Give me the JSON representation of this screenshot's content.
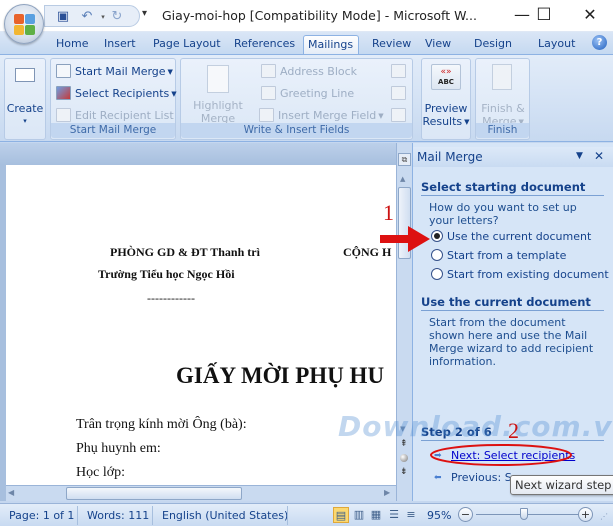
{
  "window": {
    "title": "Giay-moi-hop [Compatibility Mode] - Microsoft W...",
    "minimize": "—",
    "maximize": "☐",
    "close": "✕"
  },
  "qat": {
    "save_icon": "save-icon",
    "undo_icon": "undo-icon",
    "redo_icon": "redo-icon",
    "customize": "▾"
  },
  "tabs": [
    {
      "label": "Home"
    },
    {
      "label": "Insert"
    },
    {
      "label": "Page Layout"
    },
    {
      "label": "References"
    },
    {
      "label": "Mailings",
      "active": true
    },
    {
      "label": "Review"
    },
    {
      "label": "View"
    },
    {
      "label": "Design"
    },
    {
      "label": "Layout"
    }
  ],
  "help": "?",
  "ribbon": {
    "create": {
      "label": "Create",
      "dropdown": "▾",
      "group_label": ""
    },
    "start_mail_merge": {
      "group_label": "Start Mail Merge",
      "items": [
        {
          "label": "Start Mail Merge",
          "enabled": true
        },
        {
          "label": "Select Recipients",
          "enabled": true
        },
        {
          "label": "Edit Recipient List",
          "enabled": false
        }
      ]
    },
    "write_insert": {
      "group_label": "Write & Insert Fields",
      "highlight_line1": "Highlight",
      "highlight_line2": "Merge Fields",
      "items": [
        {
          "label": "Address Block",
          "enabled": false
        },
        {
          "label": "Greeting Line",
          "enabled": false
        },
        {
          "label": "Insert Merge Field",
          "enabled": false
        }
      ]
    },
    "preview": {
      "line1": "Preview",
      "line2": "Results",
      "icon_text_top": "«»",
      "icon_text_bottom": "ABC"
    },
    "finish": {
      "group_label": "Finish",
      "line1": "Finish &",
      "line2": "Merge"
    }
  },
  "document": {
    "header_left": "PHÒNG GD & ĐT Thanh trì",
    "header_right": "CỘNG H",
    "school": "Trường Tiểu học Ngọc Hồi",
    "divider": "------------",
    "title": "GIẤY MỜI PHỤ HU",
    "line1": "Trân trọng kính mời Ông (bà):",
    "line2": "Phụ huynh em:",
    "line3": "Học lớp:"
  },
  "task_pane": {
    "title": "Mail Merge",
    "menu_icon": "▼",
    "close_icon": "✕",
    "section1_title": "Select starting document",
    "question": "How do you want to set up your letters?",
    "options": [
      {
        "label": "Use the current document",
        "selected": true
      },
      {
        "label": "Start from a template",
        "selected": false
      },
      {
        "label": "Start from existing document",
        "selected": false
      }
    ],
    "section2_title": "Use the current document",
    "description": "Start from the document shown here and use the Mail Merge wizard to add recipient information.",
    "step": "Step 2 of 6",
    "next_link": "Next: Select recipients",
    "previous_link": "Previous: Se"
  },
  "tooltip": "Next wizard step",
  "annotations": {
    "num1": "1",
    "num2": "2",
    "watermark": "Download.com.vn"
  },
  "statusbar": {
    "page": "Page: 1 of 1",
    "words": "Words: 111",
    "language": "English (United States)",
    "zoom": "95%",
    "zoom_level_percent": 95,
    "zoom_out": "−",
    "zoom_in": "+"
  },
  "colors": {
    "accent": "#15428b",
    "annotation_red": "#cc1111",
    "link": "#0000cc"
  }
}
